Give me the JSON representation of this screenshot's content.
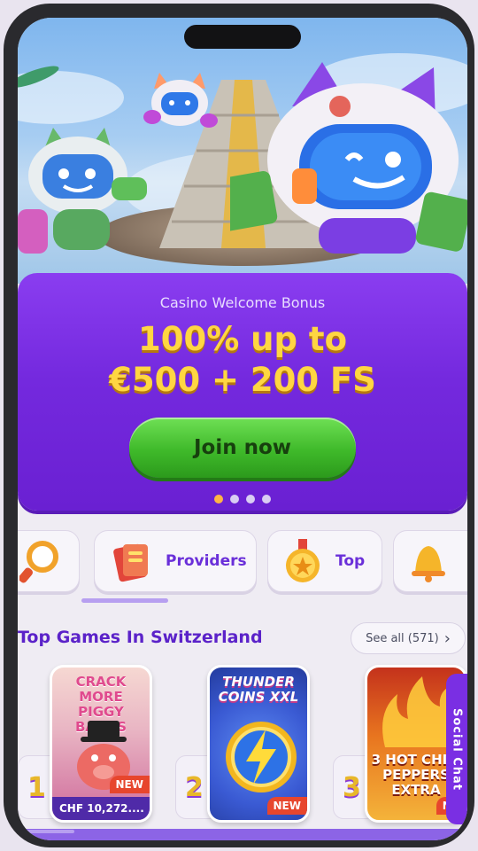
{
  "bonus": {
    "subtitle": "Casino Welcome Bonus",
    "title_line1": "100% up to",
    "title_line2": "€500 + 200 FS",
    "cta": "Join now",
    "slides": 4,
    "active_slide": 1
  },
  "categories": [
    {
      "label": "",
      "icon": "search-icon"
    },
    {
      "label": "Providers",
      "icon": "book-icon"
    },
    {
      "label": "Top",
      "icon": "star-coin-icon"
    },
    {
      "label": "",
      "icon": "bell-icon"
    }
  ],
  "games_section": {
    "title": "Top Games In Switzerland",
    "see_all": "See all (571)",
    "games": [
      {
        "rank": "1",
        "name": "Crack More Piggy Banks",
        "logo_line1": "CRACK MORE",
        "logo_line2": "PIGGY BANKS",
        "badge": "NEW",
        "jackpot": "CHF 10,272...."
      },
      {
        "rank": "2",
        "name": "Thunder Coins XXL",
        "logo_line1": "THUNDER",
        "logo_line2": "COINS XXL",
        "badge": "NEW",
        "jackpot": ""
      },
      {
        "rank": "3",
        "name": "3 Hot Chili Peppers Extra",
        "logo_line1": "3 HOT CHILI",
        "logo_line2": "PEPPERS EXTRA",
        "badge": "NE",
        "jackpot": ""
      }
    ]
  },
  "social_tab": "Social Chat",
  "colors": {
    "brand_purple": "#7429de",
    "accent_yellow": "#ffd642",
    "cta_green": "#3fb92a",
    "badge_red": "#e7462d"
  }
}
